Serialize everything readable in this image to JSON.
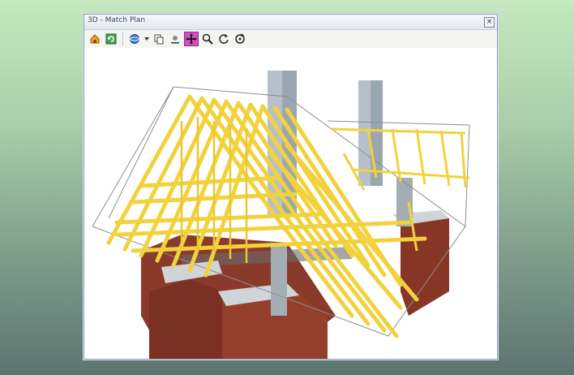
{
  "window": {
    "title": "3D - Match Plan",
    "close_glyph": "×"
  },
  "toolbar": {
    "buttons": [
      {
        "name": "home-icon",
        "tooltip": ""
      },
      {
        "name": "refresh-icon",
        "tooltip": ""
      },
      {
        "name": "view-orbit-icon",
        "tooltip": ""
      },
      {
        "name": "dropdown-arrow-icon",
        "tooltip": ""
      },
      {
        "name": "copy-icon",
        "tooltip": ""
      },
      {
        "name": "light-icon",
        "tooltip": ""
      },
      {
        "name": "pan-icon",
        "tooltip": "",
        "active": true
      },
      {
        "name": "zoom-icon",
        "tooltip": ""
      },
      {
        "name": "rotate-left-icon",
        "tooltip": ""
      },
      {
        "name": "rotate-right-icon",
        "tooltip": ""
      }
    ],
    "active_color": "#d64cc4"
  },
  "scene": {
    "truss_color": "#f2d23c",
    "brick_color": "#8a3a2a",
    "chimney_color": "#9aa6b0",
    "wireframe_color": "#8a8f8a"
  }
}
